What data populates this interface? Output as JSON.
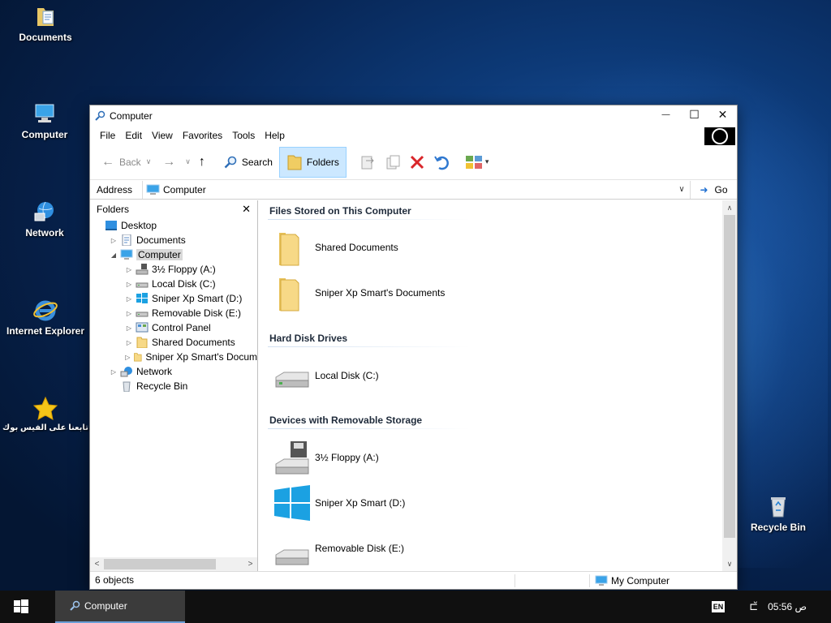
{
  "desktop": {
    "icons": [
      {
        "label": "Documents"
      },
      {
        "label": "Computer"
      },
      {
        "label": "Network"
      },
      {
        "label": "Internet Explorer"
      },
      {
        "label": "تابعنا على الفيس بوك"
      },
      {
        "label": "Recycle Bin"
      }
    ]
  },
  "window": {
    "title": "Computer",
    "controls": {
      "minimize": "—",
      "maximize": "☐",
      "close": "✕"
    },
    "menu": [
      "File",
      "Edit",
      "View",
      "Favorites",
      "Tools",
      "Help"
    ],
    "toolbar": {
      "back": "Back",
      "search": "Search",
      "folders": "Folders"
    },
    "address": {
      "label": "Address",
      "value": "Computer",
      "go": "Go"
    },
    "folders_pane": {
      "title": "Folders",
      "close": "✕",
      "tree": [
        {
          "label": "Desktop",
          "level": 0,
          "expander": ""
        },
        {
          "label": "Documents",
          "level": 1,
          "expander": "▷"
        },
        {
          "label": "Computer",
          "level": 1,
          "expander": "◢",
          "selected": true
        },
        {
          "label": "3½ Floppy (A:)",
          "level": 2,
          "expander": "▷"
        },
        {
          "label": "Local Disk (C:)",
          "level": 2,
          "expander": "▷"
        },
        {
          "label": "Sniper Xp Smart (D:)",
          "level": 2,
          "expander": "▷"
        },
        {
          "label": "Removable Disk (E:)",
          "level": 2,
          "expander": "▷"
        },
        {
          "label": "Control Panel",
          "level": 2,
          "expander": "▷"
        },
        {
          "label": "Shared Documents",
          "level": 2,
          "expander": "▷"
        },
        {
          "label": "Sniper Xp Smart's Docum",
          "level": 2,
          "expander": "▷"
        },
        {
          "label": "Network",
          "level": 1,
          "expander": "▷"
        },
        {
          "label": "Recycle Bin",
          "level": 1,
          "expander": ""
        }
      ]
    },
    "content": {
      "groups": [
        {
          "title": "Files Stored on This Computer",
          "items": [
            "Shared Documents",
            "Sniper Xp Smart's Documents"
          ]
        },
        {
          "title": "Hard Disk Drives",
          "items": [
            "Local Disk (C:)"
          ]
        },
        {
          "title": "Devices with Removable Storage",
          "items": [
            "3½ Floppy (A:)",
            "Sniper Xp Smart (D:)",
            "Removable Disk (E:)"
          ]
        }
      ]
    },
    "status": {
      "count": "6 objects",
      "location": "My Computer"
    }
  },
  "taskbar": {
    "app": "Computer",
    "lang": "EN",
    "clock": "05:56 ص"
  },
  "colors": {
    "accent": "#1f6fd1",
    "selection": "#cce8ff",
    "taskbar": "#101010"
  }
}
